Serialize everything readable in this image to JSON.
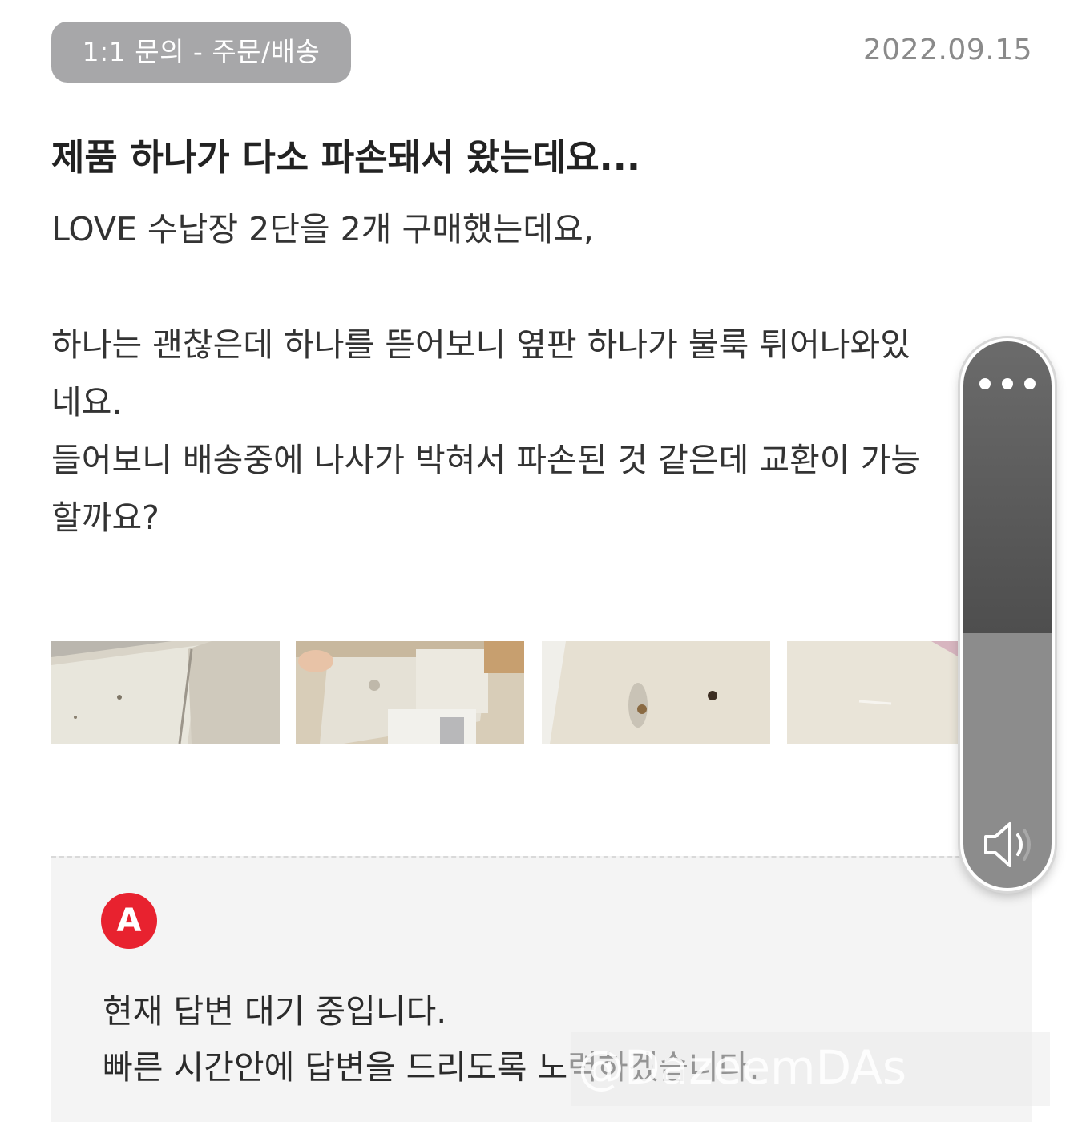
{
  "header": {
    "category": "1:1 문의 - 주문/배송",
    "date": "2022.09.15"
  },
  "question": {
    "title": "제품 하나가 다소 파손돼서 왔는데요...",
    "body": "LOVE 수납장 2단을 2개 구매했는데요,\n\n하나는 괜찮은데 하나를 뜯어보니 옆판 하나가 불룩 튀어나와있\n네요.\n들어보니 배송중에 나사가 박혀서 파손된 것 같은데 교환이 가능\n할까요?"
  },
  "attachments": [
    {
      "name": "photo-1"
    },
    {
      "name": "photo-2"
    },
    {
      "name": "photo-3"
    },
    {
      "name": "photo-4"
    }
  ],
  "answer": {
    "badge": "A",
    "line1": " 현재 답변 대기 중입니다.",
    "line2": "빠른 시간안에 답변을 드리도록 노력하겠습니다."
  },
  "volume_overlay": {
    "more_icon": "more-dots-icon",
    "speaker_icon": "speaker-icon",
    "level": 0.47
  },
  "watermark": {
    "text": "@DazeemDAs"
  },
  "colors": {
    "badge_bg": "#a7a7a9",
    "answer_badge": "#e8222f",
    "answer_bg": "#f4f4f4"
  }
}
